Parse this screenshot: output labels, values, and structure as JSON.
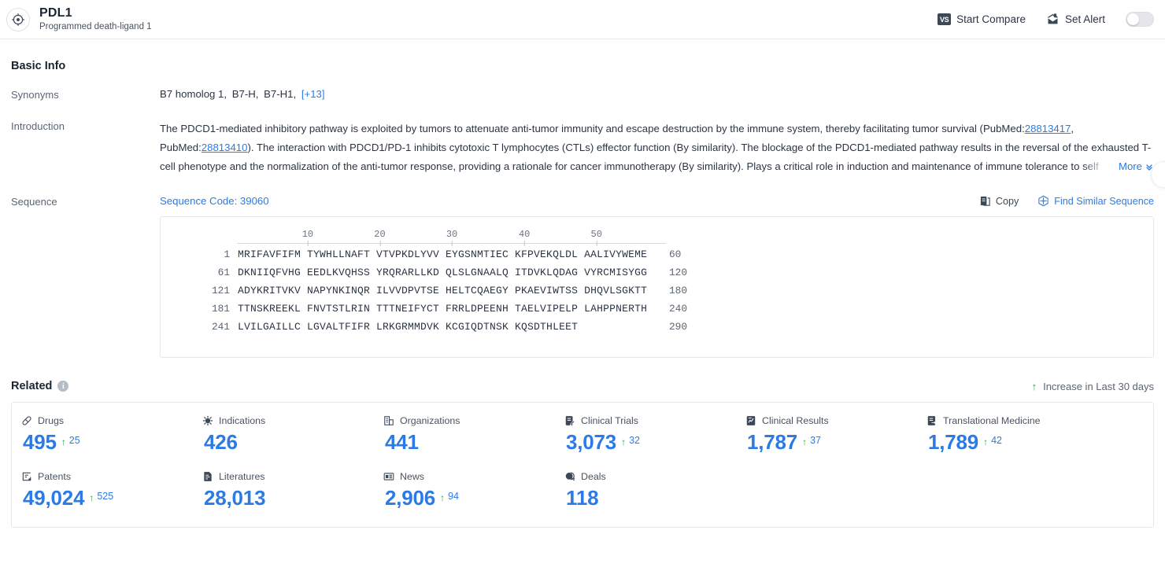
{
  "header": {
    "icon": "target-crosshair-icon",
    "title": "PDL1",
    "subtitle": "Programmed death-ligand 1",
    "compare_badge": "VS",
    "compare_label": "Start Compare",
    "alert_icon": "bell-alert-icon",
    "alert_label": "Set Alert",
    "alert_toggle_on": false
  },
  "basic_info": {
    "section_title": "Basic Info",
    "synonyms": {
      "label": "Synonyms",
      "items": [
        "B7 homolog 1,",
        "B7-H,",
        "B7-H1,"
      ],
      "more": "[+13]"
    },
    "introduction": {
      "label": "Introduction",
      "part1": "The PDCD1-mediated inhibitory pathway is exploited by tumors to attenuate anti-tumor immunity and escape destruction by the immune system, thereby facilitating tumor survival (PubMed:",
      "pubmed1": "28813417",
      "part2": ", PubMed:",
      "pubmed2": "28813410",
      "part3": "). The interaction with PDCD1/PD-1 inhibits cytotoxic T lymphocytes (CTLs) effector function (By similarity). The blockage of the PDCD1-mediated pathway results in the reversal of the exhausted T-cell phenotype and the normalization of the anti-tumor response, providing a rationale for cancer immunotherapy (By similarity). Plays a critical role in induction and maintenance of immune tolerance to self",
      "more_label": "More"
    },
    "sequence": {
      "label": "Sequence",
      "code_label": "Sequence Code: 39060",
      "copy_label": "Copy",
      "copy_icon": "copy-icon",
      "similar_label": "Find Similar Sequence",
      "similar_icon": "find-similar-icon",
      "ruler_ticks": [
        10,
        20,
        30,
        40,
        50
      ],
      "rows": [
        {
          "start": "1",
          "letters": "MRIFAVFIFM TYWHLLNAFT VTVPKDLYVV EYGSNMTIEC KFPVEKQLDL AALIVYWEME",
          "end": "60"
        },
        {
          "start": "61",
          "letters": "DKNIIQFVHG EEDLKVQHSS YRQRARLLKD QLSLGNAALQ ITDVKLQDAG VYRCMISYGG",
          "end": "120"
        },
        {
          "start": "121",
          "letters": "ADYKRITVKV NAPYNKINQR ILVVDPVTSE HELTCQAEGY PKAEVIWTSS DHQVLSGKTT",
          "end": "180"
        },
        {
          "start": "181",
          "letters": "TTNSKREEKL FNVTSTLRIN TTTNEIFYCT FRRLDPEENH TAELVIPELP LAHPPNERTH",
          "end": "240"
        },
        {
          "start": "241",
          "letters": "LVILGAILLC LGVALTFIFR LRKGRMMDVK KCGIQDTNSK KQSDTHLEET",
          "end": "290"
        }
      ]
    }
  },
  "related": {
    "title": "Related",
    "info_icon": "info-icon",
    "legend_label": "Increase in Last 30 days",
    "legend_arrow": "up-arrow-icon",
    "tiles": [
      {
        "icon": "pill-icon",
        "label": "Drugs",
        "value": "495",
        "delta": "25"
      },
      {
        "icon": "virus-icon",
        "label": "Indications",
        "value": "426",
        "delta": ""
      },
      {
        "icon": "building-icon",
        "label": "Organizations",
        "value": "441",
        "delta": ""
      },
      {
        "icon": "clinical-trial-icon",
        "label": "Clinical Trials",
        "value": "3,073",
        "delta": "32"
      },
      {
        "icon": "clinical-result-icon",
        "label": "Clinical Results",
        "value": "1,787",
        "delta": "37"
      },
      {
        "icon": "translational-icon",
        "label": "Translational Medicine",
        "value": "1,789",
        "delta": "42"
      },
      {
        "icon": "patent-icon",
        "label": "Patents",
        "value": "49,024",
        "delta": "525"
      },
      {
        "icon": "literature-icon",
        "label": "Literatures",
        "value": "28,013",
        "delta": ""
      },
      {
        "icon": "news-icon",
        "label": "News",
        "value": "2,906",
        "delta": "94"
      },
      {
        "icon": "deal-icon",
        "label": "Deals",
        "value": "118",
        "delta": ""
      }
    ]
  },
  "colors": {
    "accent_blue": "#2c7be5",
    "increase_green": "#28a745",
    "text_dark": "#2b3445",
    "text_muted": "#5c6573",
    "border": "#e4e7ec"
  }
}
